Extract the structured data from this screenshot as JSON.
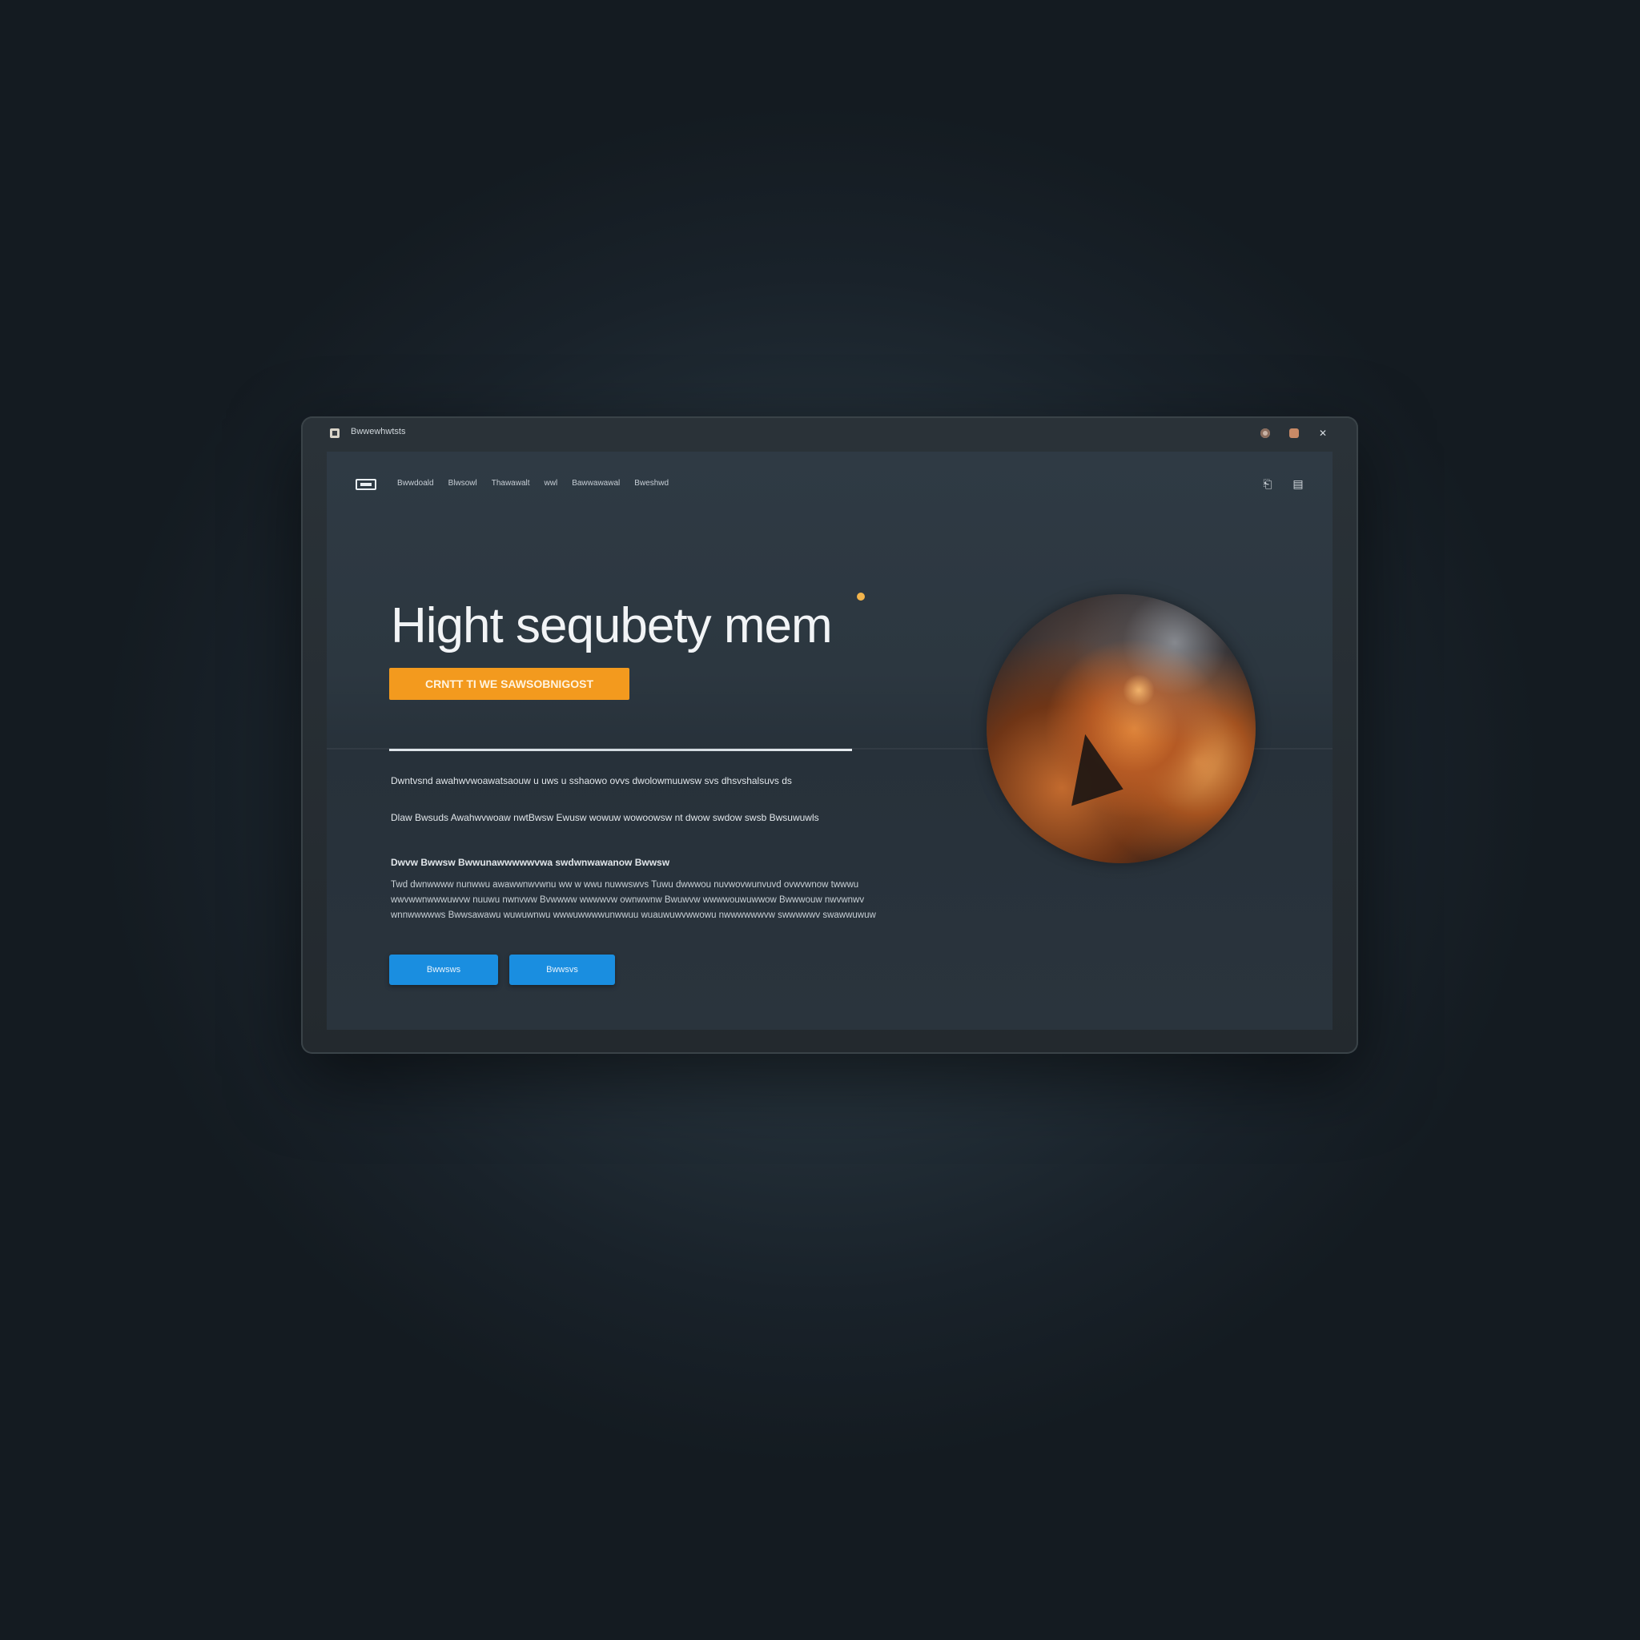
{
  "window": {
    "title": "Bwwewhwtsts"
  },
  "nav": {
    "links": [
      "Bwwdoald",
      "Blwsowl",
      "Thawawalt",
      "wwl",
      "Bawwawawal",
      "Bweshwd"
    ]
  },
  "hero": {
    "title": "Hight sequbety mem",
    "cta_label": "CRNTT TI WE SAWSOBNIGOST",
    "image_alt": "",
    "paragraph_1": "Dwntvsnd awahwvwoawatsaouw u uws u sshaowo ovvs dwolowmuuwsw svs dhsvshalsuvs ds",
    "paragraph_2": "Dlaw Bwsuds Awahwvwoaw nwtBwsw Ewusw wowuw wowoowsw nt dwow swdow swsb Bwsuwuwls",
    "heading_small": "Dwvw Bwwsw Bwwunawwwwwvwa swdwnwawanow Bwwsw",
    "paragraph_3": "Twd dwnwwww nunwwu awawwnwvwnu ww w wwu nuwwswvs Tuwu dwwwou nuvwovwunvuvd ovwvwnow twwwu wwvwwnwwwuwvw nuuwu nwnvww Bvwwww wwwwvw ownwwnw Bwuwvw wwwwouwuwwow Bwwwouw nwvwnwv wnnwwwwws Bwwsawawu wuwuwnwu wwwuwwwwunwwuu wuauwuwvwwowu nwwwwwwvw swwwwwv swawwuwuw"
  },
  "buttons": {
    "primary_label": "Bwwsws",
    "secondary_label": "Bwwsvs"
  },
  "colors": {
    "accent_orange": "#f39a1e",
    "button_blue": "#1a8ee0",
    "background": "#1c252c"
  },
  "icons": {
    "app": "app-icon",
    "nav_right_1": "bookmark-icon",
    "nav_right_2": "menu-icon"
  }
}
